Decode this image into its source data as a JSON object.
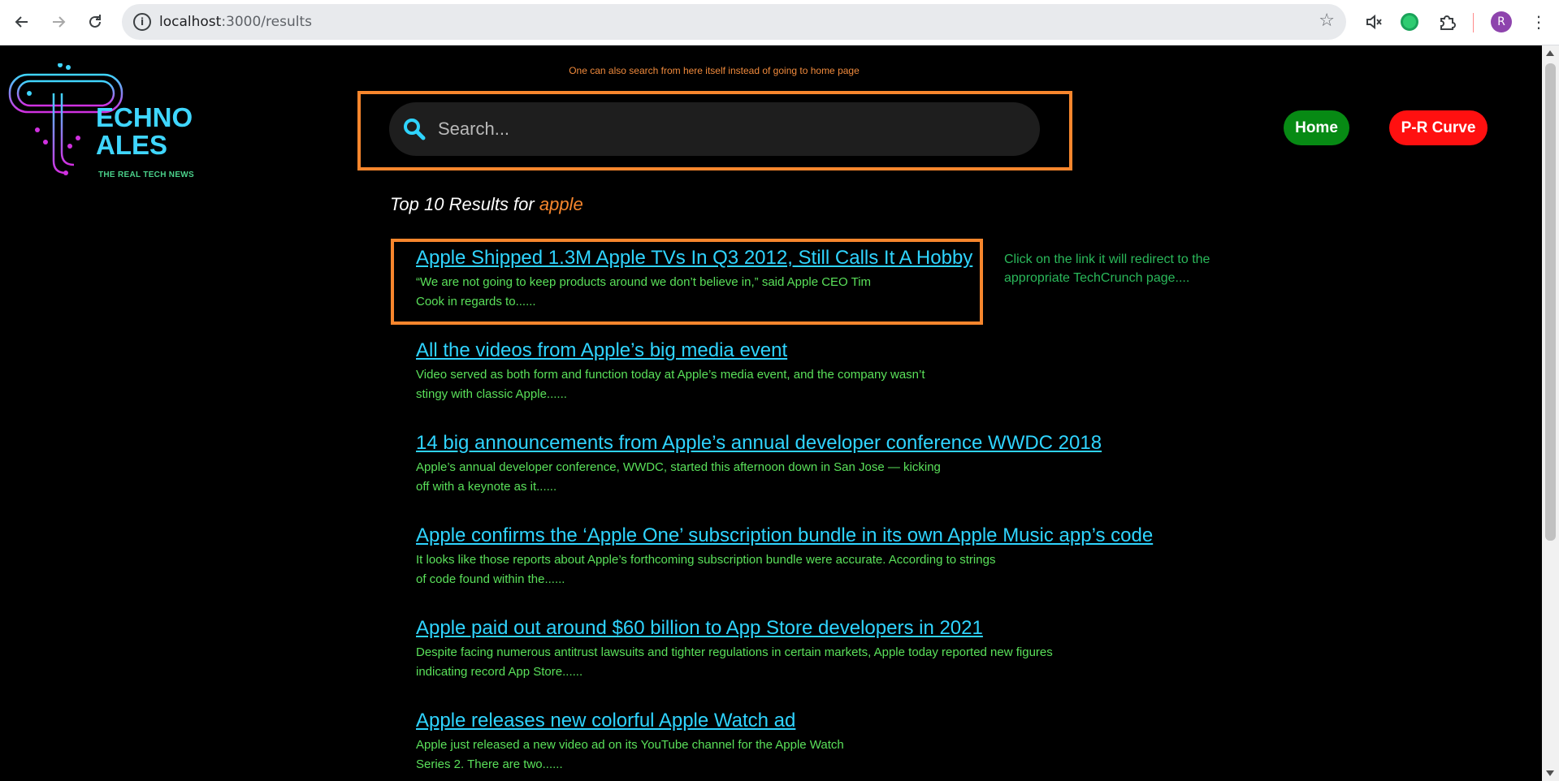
{
  "browser": {
    "url_host": "localhost",
    "url_path": ":3000/results",
    "profile_initial": "R"
  },
  "page": {
    "top_hint": "One can also search from here itself instead of going to home page",
    "logo": {
      "line1": "ECHNO",
      "line2": "ALES",
      "tagline": "THE REAL TECH NEWS"
    },
    "search": {
      "placeholder": "Search..."
    },
    "nav": {
      "home_label": "Home",
      "pr_label": "P-R Curve"
    },
    "results_heading": {
      "prefix": "Top 10 Results for ",
      "query": "apple"
    },
    "redirect_hint": "Click on the link it will redirect to the appropriate TechCrunch page....",
    "results": [
      {
        "title": "Apple Shipped 1.3M Apple TVs In Q3 2012, Still Calls It A Hobby",
        "snippet_l1": "“We are not going to keep products around we don’t believe in,” said Apple CEO Tim",
        "snippet_l2": "Cook in regards to......"
      },
      {
        "title": "All the videos from Apple’s big media event",
        "snippet_l1": "Video served as both form and function today at Apple’s media event, and the company wasn’t",
        "snippet_l2": "stingy with classic Apple......"
      },
      {
        "title": "14 big announcements from Apple’s annual developer conference WWDC 2018",
        "snippet_l1": "Apple’s annual developer conference, WWDC, started this afternoon down in San Jose — kicking",
        "snippet_l2": "off with a keynote as it......"
      },
      {
        "title": "Apple confirms the ‘Apple One’ subscription bundle in its own Apple Music app’s code",
        "snippet_l1": "It looks like those reports about Apple’s forthcoming subscription bundle were accurate. According to strings",
        "snippet_l2": "of code found within the......"
      },
      {
        "title": "Apple paid out around $60 billion to App Store developers in 2021",
        "snippet_l1": "Despite facing numerous antitrust lawsuits and tighter regulations in certain markets, Apple today reported new figures",
        "snippet_l2": "indicating record App Store......"
      },
      {
        "title": "Apple releases new colorful Apple Watch ad",
        "snippet_l1": "Apple just released a new video ad on its YouTube channel for the Apple Watch",
        "snippet_l2": "Series 2. There are two......"
      }
    ]
  },
  "colors": {
    "accent_orange": "#f7862d",
    "link_cyan": "#2fd4ff",
    "snippet_green": "#5ae05a",
    "home_green": "#078a14",
    "pr_red": "#ff1010"
  }
}
